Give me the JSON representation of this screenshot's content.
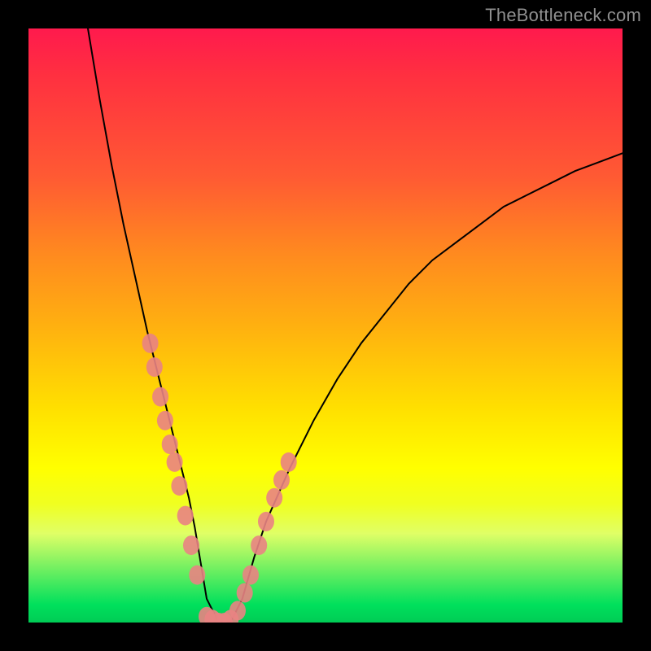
{
  "watermark": "TheBottleneck.com",
  "chart_data": {
    "type": "line",
    "title": "",
    "xlabel": "",
    "ylabel": "",
    "xlim": [
      0,
      100
    ],
    "ylim": [
      0,
      100
    ],
    "series": [
      {
        "name": "curve",
        "x": [
          10,
          12,
          14,
          16,
          18,
          20,
          21,
          22,
          23,
          24,
          25,
          26,
          27,
          28,
          29,
          30,
          32,
          34,
          36,
          38,
          40,
          44,
          48,
          52,
          56,
          60,
          64,
          68,
          72,
          76,
          80,
          84,
          88,
          92,
          96,
          100
        ],
        "y": [
          100,
          88,
          77,
          67,
          58,
          49,
          45,
          41,
          37,
          33,
          29,
          25,
          21,
          16,
          10,
          4,
          0,
          0,
          4,
          11,
          17,
          26,
          34,
          41,
          47,
          52,
          57,
          61,
          64,
          67,
          70,
          72,
          74,
          76,
          77.5,
          79
        ]
      }
    ],
    "markers": {
      "name": "pink-dots",
      "color": "#e98383",
      "points": [
        {
          "x": 20.5,
          "y": 47
        },
        {
          "x": 21.2,
          "y": 43
        },
        {
          "x": 22.2,
          "y": 38
        },
        {
          "x": 23.0,
          "y": 34
        },
        {
          "x": 23.8,
          "y": 30
        },
        {
          "x": 24.6,
          "y": 27
        },
        {
          "x": 25.4,
          "y": 23
        },
        {
          "x": 26.4,
          "y": 18
        },
        {
          "x": 27.4,
          "y": 13
        },
        {
          "x": 28.4,
          "y": 8
        },
        {
          "x": 30.0,
          "y": 1
        },
        {
          "x": 31.0,
          "y": 0.5
        },
        {
          "x": 32.0,
          "y": 0
        },
        {
          "x": 33.0,
          "y": 0
        },
        {
          "x": 34.0,
          "y": 0.5
        },
        {
          "x": 35.2,
          "y": 2
        },
        {
          "x": 36.4,
          "y": 5
        },
        {
          "x": 37.4,
          "y": 8
        },
        {
          "x": 38.8,
          "y": 13
        },
        {
          "x": 40.0,
          "y": 17
        },
        {
          "x": 41.4,
          "y": 21
        },
        {
          "x": 42.6,
          "y": 24
        },
        {
          "x": 43.8,
          "y": 27
        }
      ]
    }
  }
}
